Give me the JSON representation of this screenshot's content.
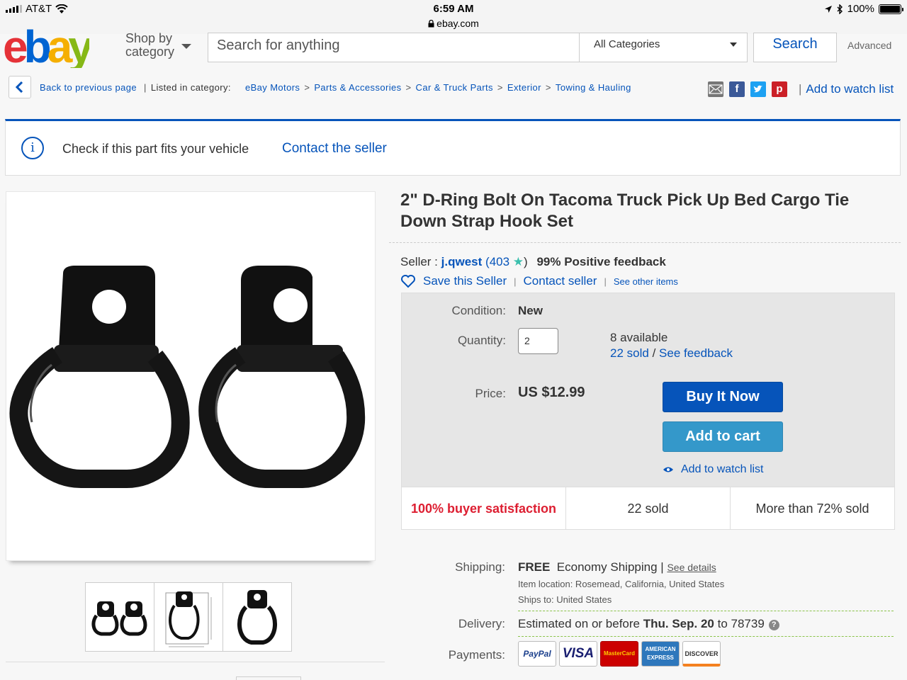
{
  "status_bar": {
    "carrier": "AT&T",
    "time": "6:59 AM",
    "url": "ebay.com",
    "battery": "100%",
    "icons": [
      "signal-bars-icon",
      "wifi-icon",
      "lock-icon",
      "location-arrow-icon",
      "bluetooth-icon",
      "battery-icon"
    ]
  },
  "header": {
    "logo_letters": [
      "e",
      "b",
      "a",
      "y"
    ],
    "shop_by_line1": "Shop by",
    "shop_by_line2": "category",
    "search_placeholder": "Search for anything",
    "category_select": "All Categories",
    "search_button": "Search",
    "advanced_link": "Advanced"
  },
  "breadcrumb": {
    "back_label": "Back to previous page",
    "listed_in": "Listed in category:",
    "items": [
      "eBay Motors",
      "Parts & Accessories",
      "Car & Truck Parts",
      "Exterior",
      "Towing & Hauling"
    ],
    "separator": ">",
    "share_icons": [
      "email-icon",
      "facebook-icon",
      "twitter-icon",
      "pinterest-icon"
    ],
    "watch_link": "Add to watch list"
  },
  "fitment": {
    "text": "Check if this part fits your vehicle",
    "contact_link": "Contact the seller"
  },
  "item": {
    "title": "2\" D-Ring Bolt On Tacoma Truck Pick Up Bed Cargo Tie Down Strap Hook Set",
    "seller_label": "Seller :",
    "seller_name": "j.qwest",
    "seller_open": "(",
    "seller_score": "403",
    "seller_close": ")",
    "feedback": "99% Positive feedback",
    "save_seller": "Save this Seller",
    "contact_seller": "Contact seller",
    "see_other": "See other items"
  },
  "buy_box": {
    "condition_label": "Condition:",
    "condition_value": "New",
    "quantity_label": "Quantity:",
    "quantity_value": "2",
    "available": "8 available",
    "sold_link": "22 sold",
    "slash": "/",
    "feedback_link": "See feedback",
    "price_label": "Price:",
    "price_value": "US $12.99",
    "buy_now": "Buy It Now",
    "add_to_cart": "Add to cart",
    "add_to_watch": "Add to watch list",
    "stats": [
      "100% buyer satisfaction",
      "22 sold",
      "More than 72% sold"
    ]
  },
  "shipping": {
    "shipping_label": "Shipping:",
    "free": "FREE",
    "method": "Economy Shipping",
    "pipe": "|",
    "details_link": "See details",
    "location": "Item location:  Rosemead, California, United States",
    "ships_to": "Ships to:  United States",
    "delivery_label": "Delivery:",
    "delivery_prefix": "Estimated on or before",
    "delivery_date": "Thu. Sep. 20",
    "delivery_suffix": "to 78739",
    "help_icon": "?",
    "payments_label": "Payments:",
    "payment_methods": [
      "PayPal",
      "VISA",
      "MasterCard",
      "AMERICAN EXPRESS",
      "DISCOVER"
    ]
  },
  "colors": {
    "link": "#0654ba",
    "buy_now": "#0654ba",
    "add_to_cart": "#3498ca",
    "satisfaction_red": "#dd1e31",
    "logo_e": "#e53238",
    "logo_b": "#0064d2",
    "logo_a": "#f5af02",
    "logo_y": "#86b817"
  }
}
